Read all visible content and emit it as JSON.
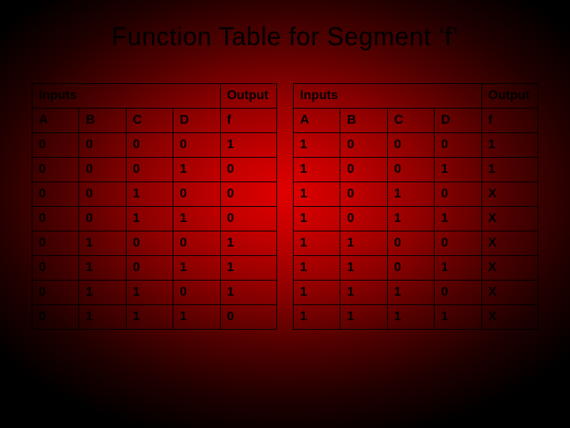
{
  "title": "Function Table for Segment ‘f’",
  "group_headers": {
    "inputs": "Inputs",
    "output": "Output"
  },
  "col_headers": [
    "A",
    "B",
    "C",
    "D",
    "f"
  ],
  "left_rows": [
    [
      "0",
      "0",
      "0",
      "0",
      "1"
    ],
    [
      "0",
      "0",
      "0",
      "1",
      "0"
    ],
    [
      "0",
      "0",
      "1",
      "0",
      "0"
    ],
    [
      "0",
      "0",
      "1",
      "1",
      "0"
    ],
    [
      "0",
      "1",
      "0",
      "0",
      "1"
    ],
    [
      "0",
      "1",
      "0",
      "1",
      "1"
    ],
    [
      "0",
      "1",
      "1",
      "0",
      "1"
    ],
    [
      "0",
      "1",
      "1",
      "1",
      "0"
    ]
  ],
  "right_rows": [
    [
      "1",
      "0",
      "0",
      "0",
      "1"
    ],
    [
      "1",
      "0",
      "0",
      "1",
      "1"
    ],
    [
      "1",
      "0",
      "1",
      "0",
      "X"
    ],
    [
      "1",
      "0",
      "1",
      "1",
      "X"
    ],
    [
      "1",
      "1",
      "0",
      "0",
      "X"
    ],
    [
      "1",
      "1",
      "0",
      "1",
      "X"
    ],
    [
      "1",
      "1",
      "1",
      "0",
      "X"
    ],
    [
      "1",
      "1",
      "1",
      "1",
      "X"
    ]
  ]
}
